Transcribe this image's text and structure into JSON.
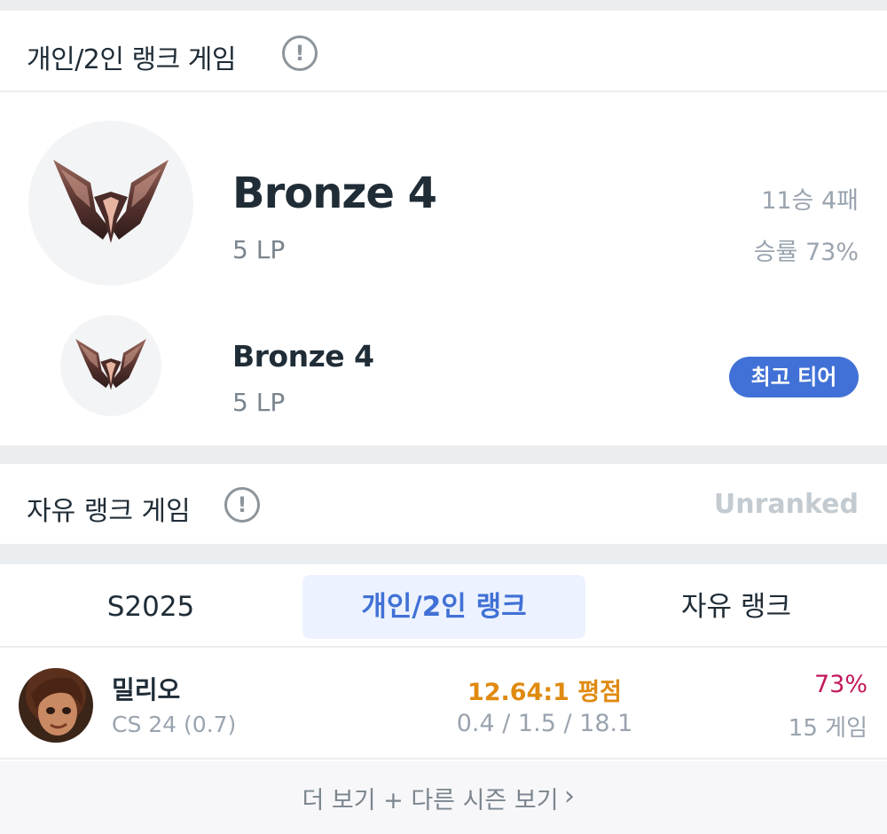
{
  "solo_rank": {
    "title": "개인/2인 랭크 게임",
    "info_icon": "!",
    "current": {
      "tier": "Bronze 4",
      "lp": "5 LP",
      "record": "11승 4패",
      "win_rate": "승률 73%"
    },
    "best": {
      "tier": "Bronze 4",
      "lp": "5 LP",
      "badge": "최고 티어"
    }
  },
  "flex_rank": {
    "title": "자유 랭크 게임",
    "info_icon": "!",
    "status": "Unranked"
  },
  "champion_stats": {
    "tabs": [
      "S2025",
      "개인/2인 랭크",
      "자유 랭크"
    ],
    "active_tab": 1,
    "rows": [
      {
        "champion": "밀리오",
        "cs": "CS 24 (0.7)",
        "kda_ratio": "12.64:1 평점",
        "kda_detail": "0.4 / 1.5 / 18.1",
        "win_rate": "73%",
        "games": "15 게임"
      }
    ],
    "more_label": "더 보기 + 다른 시즌 보기",
    "more_icon": "chevron-right-icon"
  },
  "colors": {
    "accent": "#4171d6",
    "kda_highlight": "#e08a10",
    "win_rate_highlight": "#c2185b",
    "bronze_emblem": "#7a4a40"
  }
}
